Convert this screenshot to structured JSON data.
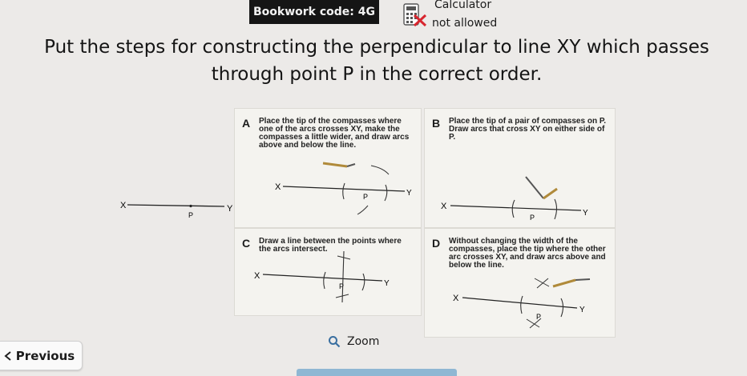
{
  "header": {
    "bookwork_code": "Bookwork code: 4G",
    "calculator_label": "Calculator",
    "calculator_status": "not allowed"
  },
  "question": {
    "text": "Put the steps for constructing the perpendicular to line XY which passes through point P in the correct order."
  },
  "figure": {
    "x_label": "X",
    "y_label": "Y",
    "p_label": "P"
  },
  "cards": [
    {
      "letter": "A",
      "text": "Place the tip of the compasses where one of the arcs crosses XY, make the compasses a little wider, and draw arcs above and below the line."
    },
    {
      "letter": "B",
      "text": "Place the tip of a pair of compasses on P. Draw arcs that cross XY on either side of P."
    },
    {
      "letter": "C",
      "text": "Draw a line between the points where the arcs intersect."
    },
    {
      "letter": "D",
      "text": "Without changing the width of the compasses, place the tip where the other arc crosses XY, and draw arcs above and below the line."
    }
  ],
  "controls": {
    "zoom_label": "Zoom",
    "previous_label": "Previous"
  },
  "icons": {
    "calculator": "calculator-crossed-icon",
    "zoom": "magnifier-icon",
    "previous": "chevron-left-icon"
  },
  "colors": {
    "bookwork_bg": "#151515",
    "cross_red": "#d8262f",
    "bottom_bar": "#8fb7d3"
  }
}
